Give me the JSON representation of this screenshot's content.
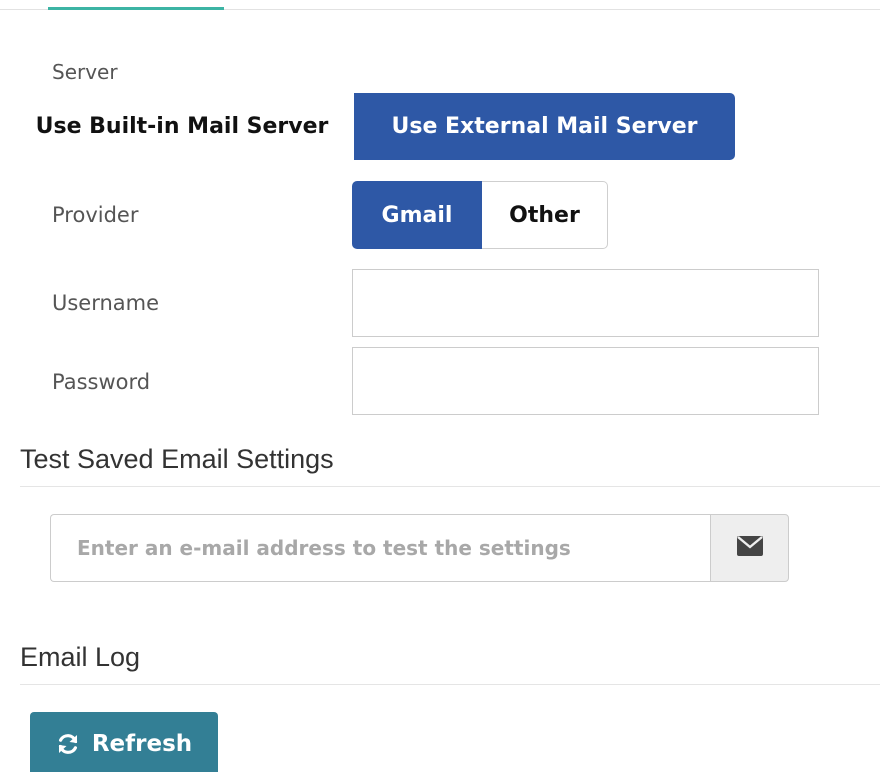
{
  "tabs": {
    "active_indicator_color": "#3cb4a4"
  },
  "server": {
    "label": "Server",
    "options": [
      "Use Built-in Mail Server",
      "Use External Mail Server"
    ],
    "selected": "Use External Mail Server"
  },
  "provider": {
    "label": "Provider",
    "options": [
      "Gmail",
      "Other"
    ],
    "selected": "Gmail"
  },
  "username": {
    "label": "Username",
    "value": ""
  },
  "password": {
    "label": "Password",
    "value": ""
  },
  "test_section": {
    "title": "Test Saved Email Settings",
    "placeholder": "Enter an e-mail address to test the settings",
    "send_icon": "envelope-icon"
  },
  "log_section": {
    "title": "Email Log",
    "refresh_label": "Refresh",
    "refresh_icon": "refresh-icon"
  },
  "colors": {
    "primary": "#2e58a6",
    "refresh_button": "#337f95",
    "accent": "#3cb4a4"
  }
}
